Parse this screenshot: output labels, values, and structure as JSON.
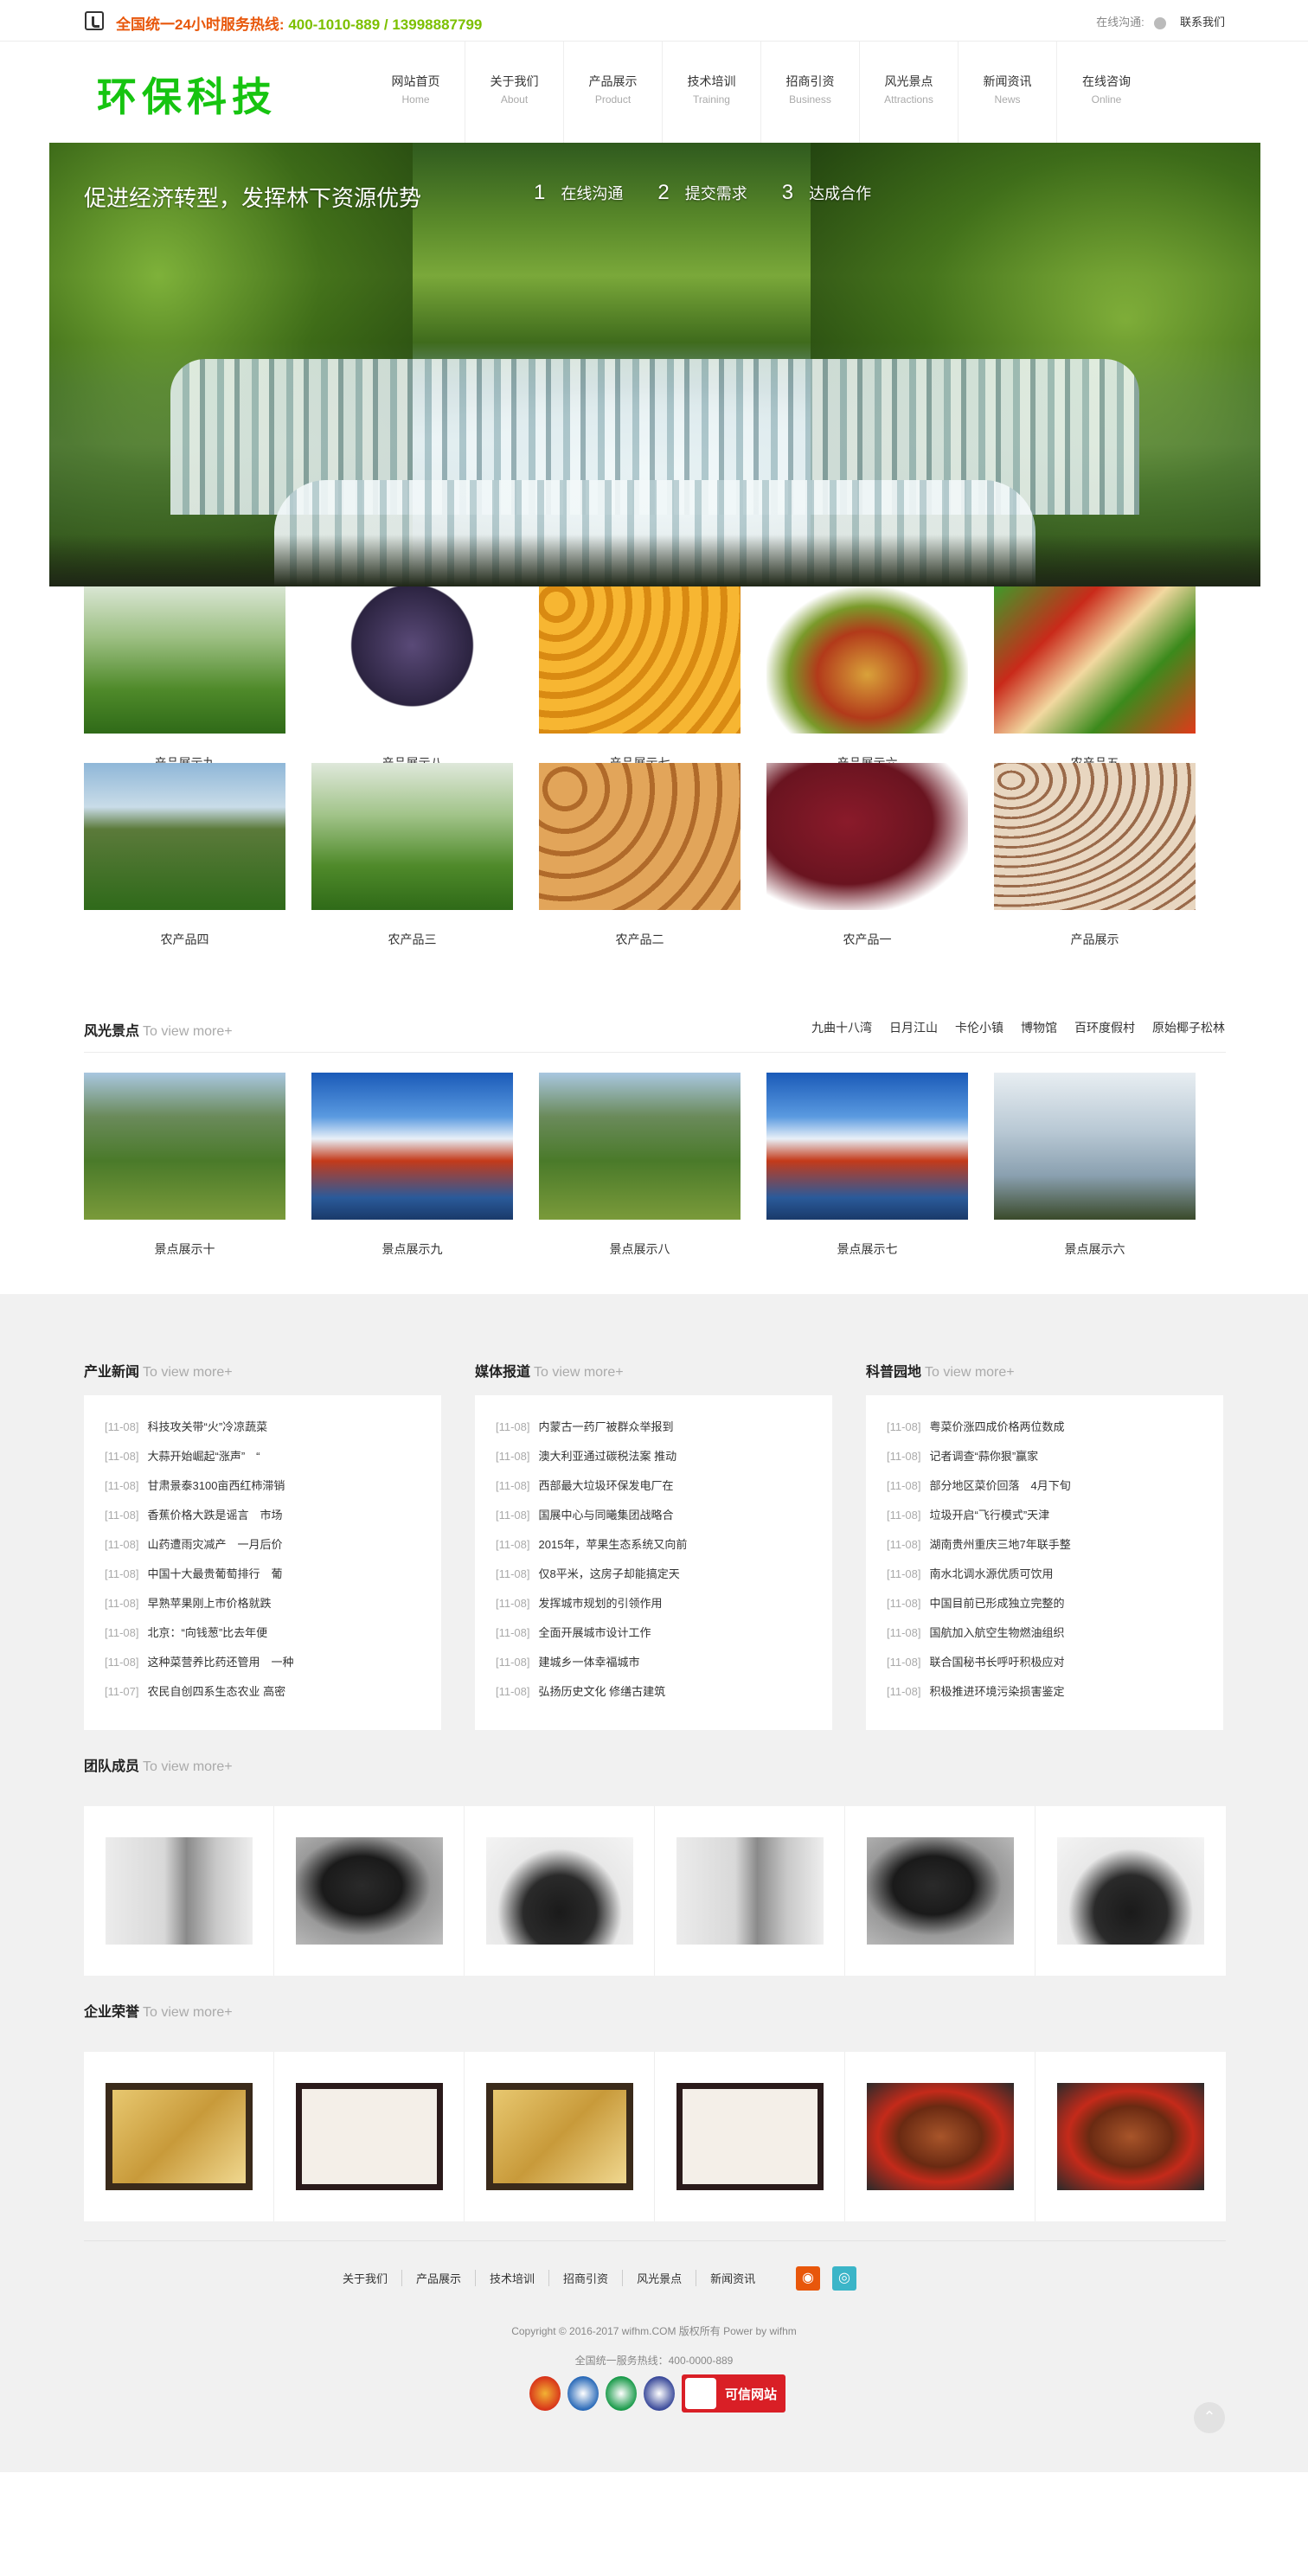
{
  "topbar": {
    "hotline": "全国统一24小时服务热线:",
    "phones": "400-1010-889 / 13998887799",
    "online_label": "在线沟通:",
    "contact_label": "联系我们"
  },
  "header": {
    "logo_text": "环保科技",
    "nav": [
      {
        "cn": "网站首页",
        "en": "Home"
      },
      {
        "cn": "关于我们",
        "en": "About"
      },
      {
        "cn": "产品展示",
        "en": "Product"
      },
      {
        "cn": "技术培训",
        "en": "Training"
      },
      {
        "cn": "招商引资",
        "en": "Business"
      },
      {
        "cn": "风光景点",
        "en": "Attractions"
      },
      {
        "cn": "新闻资讯",
        "en": "News"
      },
      {
        "cn": "在线咨询",
        "en": "Online"
      }
    ]
  },
  "banner": {
    "slogan": "促进经济转型，发挥林下资源优势",
    "steps": [
      {
        "num": "1",
        "label": "在线沟通"
      },
      {
        "num": "2",
        "label": "提交需求"
      },
      {
        "num": "3",
        "label": "达成合作"
      }
    ]
  },
  "products": [
    {
      "caption": "产品展示九",
      "image": "greenhouse-seedlings"
    },
    {
      "caption": "产品展示八",
      "image": "grapes"
    },
    {
      "caption": "产品展示七",
      "image": "oranges"
    },
    {
      "caption": "产品展示六",
      "image": "fruit-basket"
    },
    {
      "caption": "农产品五",
      "image": "vegetables"
    },
    {
      "caption": "农产品四",
      "image": "field"
    },
    {
      "caption": "农产品三",
      "image": "greenhouse-seedlings"
    },
    {
      "caption": "农产品二",
      "image": "potatoes"
    },
    {
      "caption": "农产品一",
      "image": "red-beans"
    },
    {
      "caption": "产品展示",
      "image": "pinto-beans"
    }
  ],
  "scenery": {
    "title": "风光景点",
    "more": "To view more+",
    "tags": [
      "九曲十八湾",
      "日月江山",
      "卡伦小镇",
      "博物馆",
      "百环度假村",
      "原始椰子松林"
    ],
    "items": [
      {
        "caption": "景点展示十",
        "image": "mountain-village"
      },
      {
        "caption": "景点展示九",
        "image": "lake-blue-sky"
      },
      {
        "caption": "景点展示八",
        "image": "mountain-village"
      },
      {
        "caption": "景点展示七",
        "image": "lake-blue-sky"
      },
      {
        "caption": "景点展示六",
        "image": "lakeside-tree"
      }
    ]
  },
  "news": [
    {
      "title": "产业新闻",
      "more": "To view more+",
      "items": [
        {
          "date": "[11-08]",
          "text": "科技攻关带“火”冷凉蔬菜"
        },
        {
          "date": "[11-08]",
          "text": "大蒜开始崛起“涨声”　“"
        },
        {
          "date": "[11-08]",
          "text": "甘肃景泰3100亩西红柿滞销"
        },
        {
          "date": "[11-08]",
          "text": "香蕉价格大跌是谣言　市场"
        },
        {
          "date": "[11-08]",
          "text": "山药遭雨灾减产　一月后价"
        },
        {
          "date": "[11-08]",
          "text": "中国十大最贵葡萄排行　葡"
        },
        {
          "date": "[11-08]",
          "text": "早熟苹果刚上市价格就跌"
        },
        {
          "date": "[11-08]",
          "text": "北京：“向钱葱”比去年便"
        },
        {
          "date": "[11-08]",
          "text": "这种菜营养比药还管用　一种"
        },
        {
          "date": "[11-07]",
          "text": "农民自创四系生态农业 高密"
        }
      ]
    },
    {
      "title": "媒体报道",
      "more": "To view more+",
      "items": [
        {
          "date": "[11-08]",
          "text": "内蒙古一药厂被群众举报到"
        },
        {
          "date": "[11-08]",
          "text": "澳大利亚通过碳税法案 推动"
        },
        {
          "date": "[11-08]",
          "text": "西部最大垃圾环保发电厂在"
        },
        {
          "date": "[11-08]",
          "text": "国展中心与同曦集团战略合"
        },
        {
          "date": "[11-08]",
          "text": "2015年，苹果生态系统又向前"
        },
        {
          "date": "[11-08]",
          "text": "仅8平米，这房子却能搞定天"
        },
        {
          "date": "[11-08]",
          "text": "发挥城市规划的引领作用"
        },
        {
          "date": "[11-08]",
          "text": "全面开展城市设计工作"
        },
        {
          "date": "[11-08]",
          "text": "建城乡一体幸福城市"
        },
        {
          "date": "[11-08]",
          "text": "弘扬历史文化 修缮古建筑"
        }
      ]
    },
    {
      "title": "科普园地",
      "more": "To view more+",
      "items": [
        {
          "date": "[11-08]",
          "text": "粤菜价涨四成价格两位数成"
        },
        {
          "date": "[11-08]",
          "text": "记者调查“蒜你狠”赢家"
        },
        {
          "date": "[11-08]",
          "text": "部分地区菜价回落　4月下旬"
        },
        {
          "date": "[11-08]",
          "text": "垃圾开启“飞行模式”天津"
        },
        {
          "date": "[11-08]",
          "text": "湖南贵州重庆三地7年联手整"
        },
        {
          "date": "[11-08]",
          "text": "南水北调水源优质可饮用"
        },
        {
          "date": "[11-08]",
          "text": "中国目前已形成独立完整的"
        },
        {
          "date": "[11-08]",
          "text": "国航加入航空生物燃油组织"
        },
        {
          "date": "[11-08]",
          "text": "联合国秘书长呼吁积极应对"
        },
        {
          "date": "[11-08]",
          "text": "积极推进环境污染损害鉴定"
        }
      ]
    }
  ],
  "team": {
    "title": "团队成员",
    "more": "To view more+",
    "members": [
      "man-painter",
      "woman-sofa",
      "man-glasses",
      "man-painter",
      "woman-sofa",
      "man-glasses"
    ]
  },
  "honors": {
    "title": "企业荣誉",
    "more": "To view more+",
    "items": [
      "gold-plaque",
      "certificate",
      "gold-plaque",
      "certificate",
      "roast-duck",
      "roast-duck"
    ]
  },
  "footer": {
    "links": [
      "关于我们",
      "产品展示",
      "技术培训",
      "招商引资",
      "风光景点",
      "新闻资讯"
    ],
    "copyright": "Copyright © 2016-2017 wifhm.COM 版权所有 Power by wifhm",
    "service": "全国统一服务热线：400-0000-889",
    "badge_text": "可信网站"
  },
  "colors": {
    "accent_orange": "#e8570b",
    "accent_green": "#7cc000",
    "logo_green": "#16c410"
  }
}
